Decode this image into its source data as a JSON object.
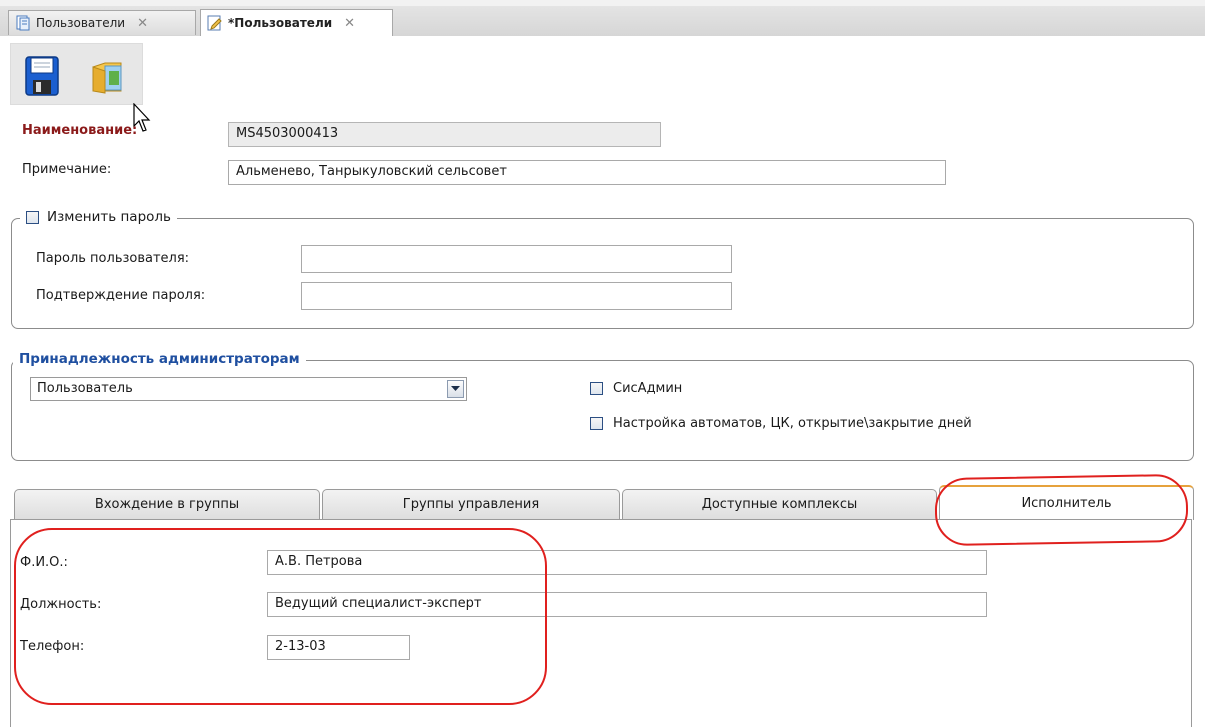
{
  "tabs": [
    {
      "label": "Пользователи",
      "active": false
    },
    {
      "label": "*Пользователи",
      "active": true
    }
  ],
  "icons": {
    "close": "close-icon",
    "save": "floppy-save-icon",
    "open": "folder-icon",
    "doc": "document-icon",
    "edit": "edit-document-icon"
  },
  "form": {
    "name_label": "Наименование:",
    "name_value": "MS4503000413",
    "note_label": "Примечание:",
    "note_value": "Альменево, Танрыкуловский сельсовет"
  },
  "password": {
    "legend": "Изменить пароль",
    "checked": false,
    "user_password_label": "Пароль пользователя:",
    "user_password_value": "",
    "confirm_label": "Подтверждение пароля:",
    "confirm_value": ""
  },
  "admins": {
    "legend": "Принадлежность администраторам",
    "role_selected": "Пользователь",
    "sysadmin_label": "СисАдмин",
    "sysadmin_checked": false,
    "automation_label": "Настройка автоматов, ЦК, открытие\\закрытие дней",
    "automation_checked": false
  },
  "inner_tabs": [
    {
      "label": "Вхождение в группы",
      "active": false
    },
    {
      "label": "Группы управления",
      "active": false
    },
    {
      "label": "Доступные комплексы",
      "active": false
    },
    {
      "label": "Исполнитель",
      "active": true
    }
  ],
  "executor": {
    "fio_label": "Ф.И.О.:",
    "fio_value": "А.В. Петрова",
    "position_label": "Должность:",
    "position_value": "Ведущий специалист-эксперт",
    "phone_label": "Телефон:",
    "phone_value": "2-13-03"
  },
  "colors": {
    "accent_red": "#e0201e",
    "required_label": "#8b1a1a",
    "legend_blue": "#1f4fa0",
    "active_tab_top": "#e6a23c"
  }
}
